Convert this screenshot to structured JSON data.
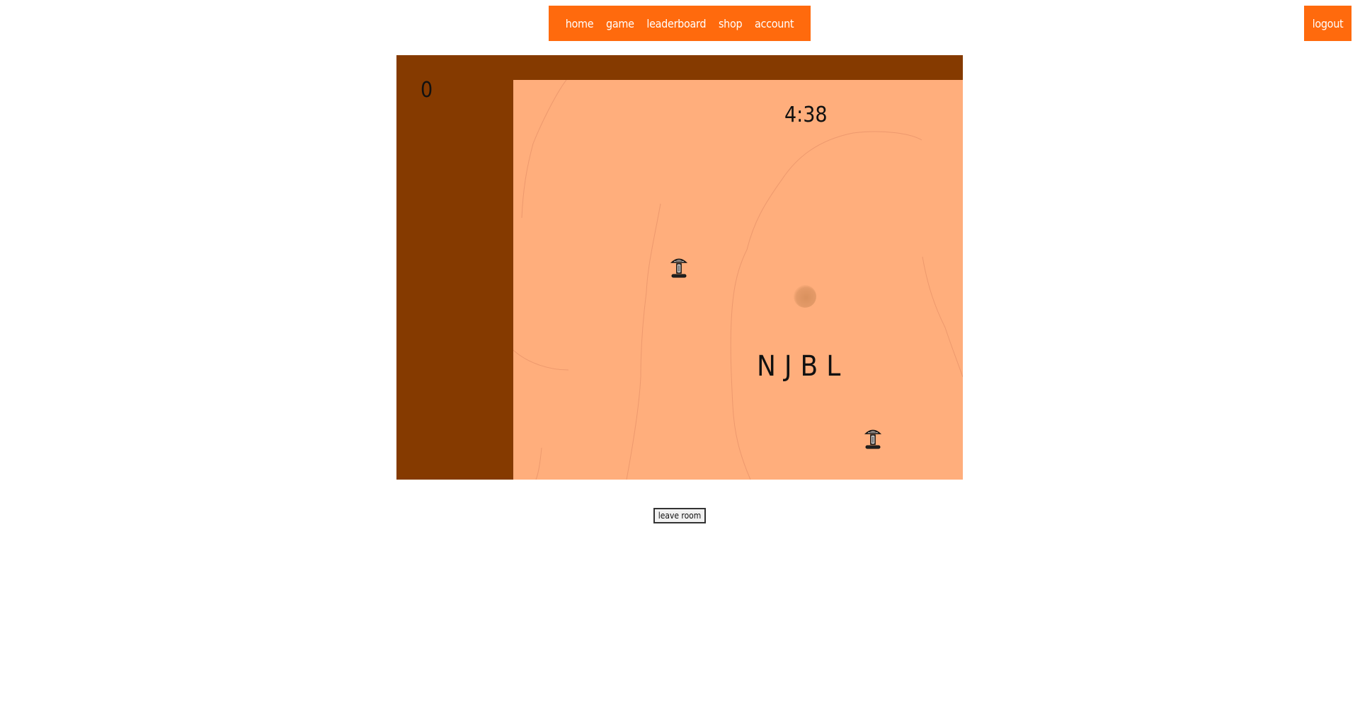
{
  "nav": {
    "items": [
      {
        "label": "home"
      },
      {
        "label": "game"
      },
      {
        "label": "leaderboard"
      },
      {
        "label": "shop"
      },
      {
        "label": "account"
      }
    ],
    "logout_label": "logout"
  },
  "game": {
    "score": "0",
    "timer": "4:38",
    "word": "NJBL",
    "colors": {
      "border": "#853a00",
      "arena": "#ffae7c",
      "nav": "#ff6a0d"
    },
    "players": [
      {
        "icon": "desk-lamp-player-icon"
      },
      {
        "icon": "desk-lamp-player-icon"
      }
    ]
  },
  "controls": {
    "leave_room_label": "leave room"
  }
}
